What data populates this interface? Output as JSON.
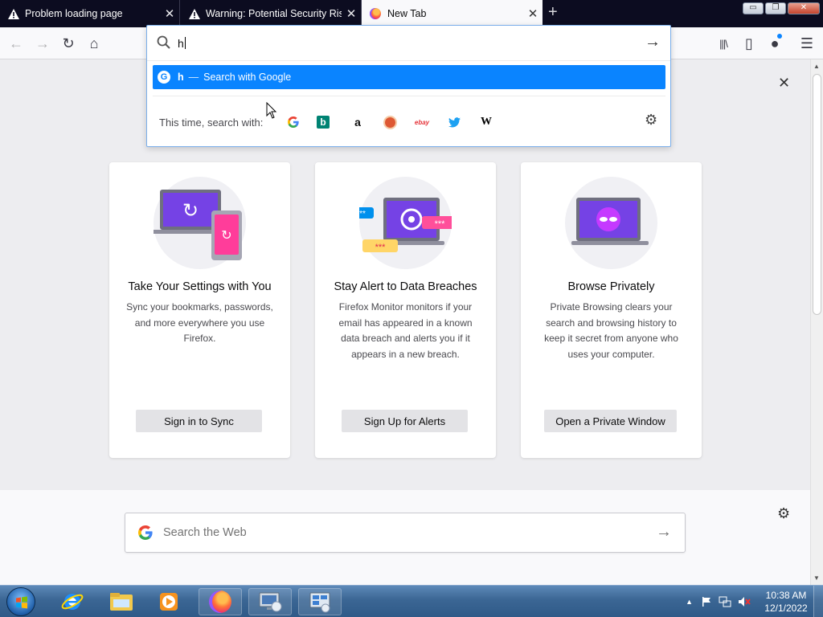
{
  "tabs": [
    {
      "label": "Problem loading page",
      "icon": "warning-icon",
      "close_label": "✕"
    },
    {
      "label": "Warning: Potential Security Risk Ahead",
      "icon": "warning-icon",
      "close_label": "✕"
    },
    {
      "label": "New Tab",
      "icon": "firefox-icon",
      "close_label": "✕",
      "active": true
    }
  ],
  "new_tab_label": "+",
  "window_controls": {
    "minimize": "▭",
    "restore": "❐",
    "close": "✕"
  },
  "toolbar": {
    "back": "←",
    "forward": "→",
    "reload": "↻",
    "home": "⌂",
    "library": "|||\\",
    "sidebar": "▯",
    "account": "●",
    "menu": "☰"
  },
  "urlbar": {
    "typed_value": "h",
    "search_icon": "search-icon",
    "go_label": "→"
  },
  "suggestion": {
    "query": "h",
    "separator": "—",
    "action": "Search with Google"
  },
  "one_off": {
    "label": "This time, search with:",
    "engines": [
      {
        "name": "Google",
        "glyph": "G",
        "color": "#4285f4"
      },
      {
        "name": "Bing",
        "glyph": "b",
        "color": "#008373"
      },
      {
        "name": "Amazon",
        "glyph": "a",
        "color": "#111111"
      },
      {
        "name": "DuckDuckGo",
        "glyph": "◉",
        "color": "#de5833"
      },
      {
        "name": "eBay",
        "glyph": "ebay",
        "color": "#e53238"
      },
      {
        "name": "Twitter",
        "glyph": "🐦",
        "color": "#1da1f2"
      },
      {
        "name": "Wikipedia",
        "glyph": "W",
        "color": "#000000"
      }
    ],
    "settings_icon": "gear-icon"
  },
  "dismiss_label": "✕",
  "cards": [
    {
      "title": "Take Your Settings with You",
      "desc": "Sync your bookmarks, passwords, and more everywhere you use Firefox.",
      "button": "Sign in to Sync"
    },
    {
      "title": "Stay Alert to Data Breaches",
      "desc": "Firefox Monitor monitors if your email has appeared in a known data breach and alerts you if it appears in a new breach.",
      "button": "Sign Up for Alerts"
    },
    {
      "title": "Browse Privately",
      "desc": "Private Browsing clears your search and browsing history to keep it secret from anyone who uses your computer.",
      "button": "Open a Private Window"
    }
  ],
  "web_search": {
    "placeholder": "Search the Web",
    "arrow": "→"
  },
  "settings_gear": "⚙",
  "taskbar": {
    "apps": [
      "Internet Explorer",
      "Windows Explorer",
      "Windows Media Player",
      "Firefox",
      "Remote Desktop",
      "Network"
    ],
    "clock_time": "10:38 AM",
    "clock_date": "12/1/2022"
  }
}
